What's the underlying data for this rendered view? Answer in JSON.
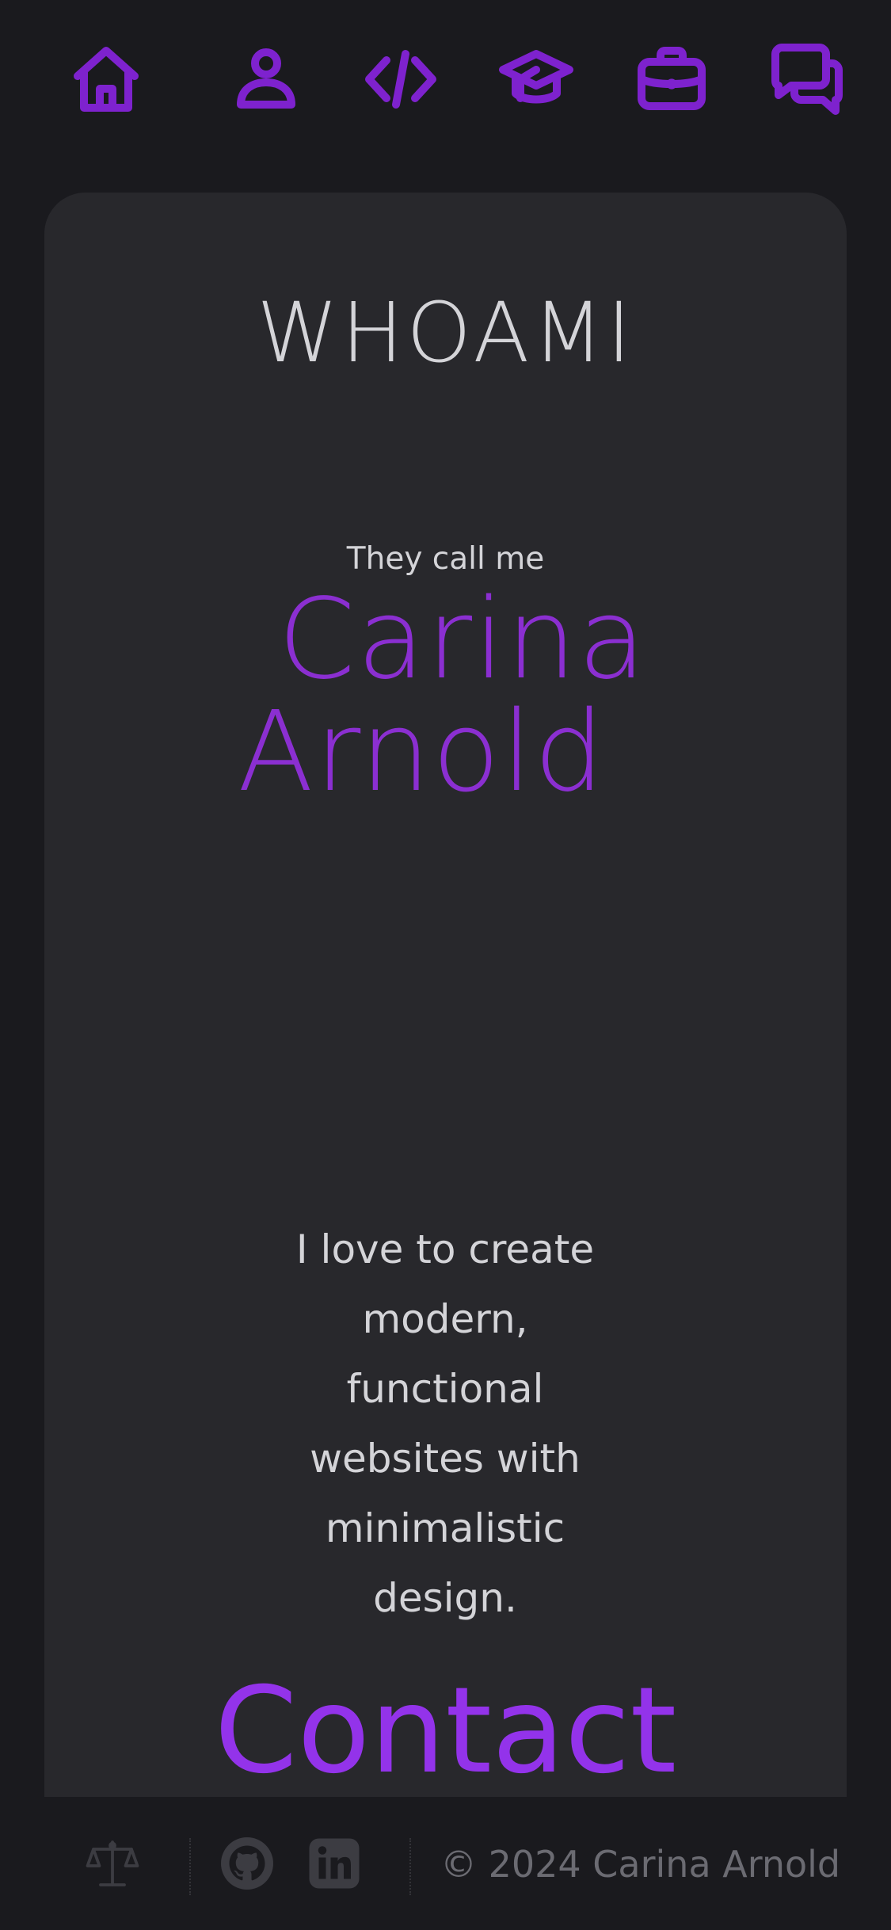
{
  "nav": {
    "items": [
      {
        "icon": "home-icon"
      },
      {
        "icon": "user-icon"
      },
      {
        "icon": "code-icon"
      },
      {
        "icon": "graduation-cap-icon"
      },
      {
        "icon": "briefcase-icon"
      },
      {
        "icon": "chat-icon"
      }
    ],
    "icon_color": "#7e22ce"
  },
  "hero": {
    "section_title": "WHOAMI",
    "intro": "They call me",
    "first_name": "Carina",
    "last_name": "Arnold",
    "tagline": "I love to create modern, functional websites with minimalistic design.",
    "accent_color": "#8b2fd1"
  },
  "contact": {
    "label": "Contact"
  },
  "footer": {
    "icons": [
      "scale-icon",
      "github-icon",
      "linkedin-icon"
    ],
    "copyright": "© 2024 Carina Arnold"
  }
}
